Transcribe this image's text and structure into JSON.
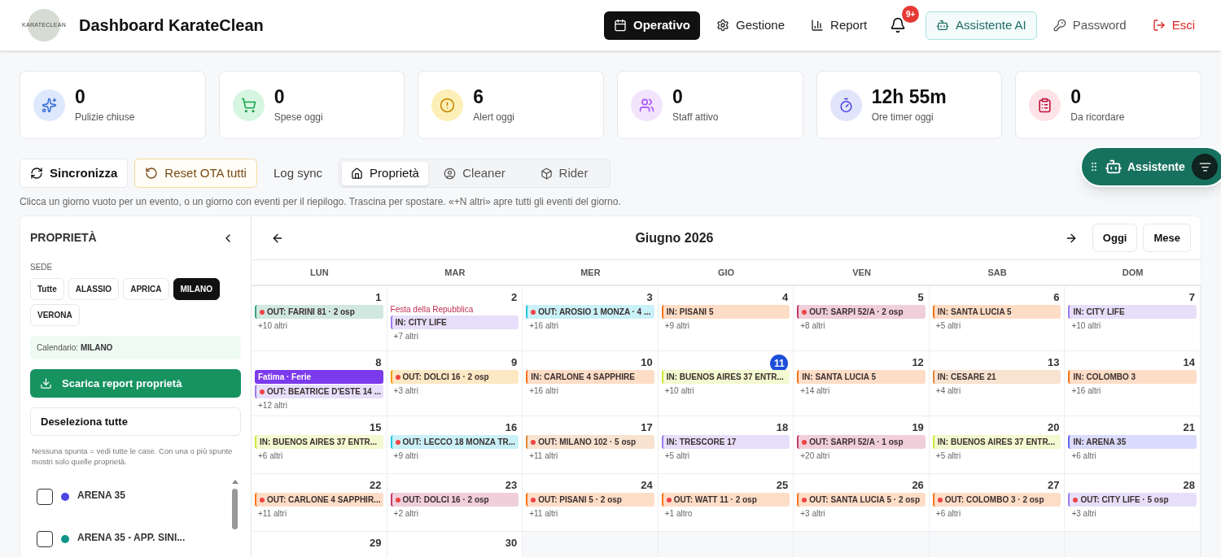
{
  "header": {
    "logo_text": "KARATECLEAN",
    "title": "Dashboard KarateClean",
    "nav": [
      {
        "label": "Operativo",
        "selected": true
      },
      {
        "label": "Gestione",
        "selected": false
      },
      {
        "label": "Report",
        "selected": false
      }
    ],
    "notifications_badge": "9+",
    "actions": [
      {
        "label": "Assistente AI",
        "kind": "ai"
      },
      {
        "label": "Password",
        "kind": "plain"
      },
      {
        "label": "Esci",
        "kind": "danger"
      }
    ]
  },
  "stats": [
    {
      "value": "0",
      "label": "Pulizie chiuse"
    },
    {
      "value": "0",
      "label": "Spese oggi"
    },
    {
      "value": "6",
      "label": "Alert oggi"
    },
    {
      "value": "0",
      "label": "Staff attivo"
    },
    {
      "value": "12h 55m",
      "label": "Ore timer oggi"
    },
    {
      "value": "0",
      "label": "Da ricordare"
    }
  ],
  "toolbar": {
    "sync": "Sincronizza",
    "reset": "Reset OTA tutti",
    "log": "Log sync",
    "views": [
      {
        "label": "Proprietà",
        "selected": true
      },
      {
        "label": "Cleaner",
        "selected": false
      },
      {
        "label": "Rider",
        "selected": false
      }
    ]
  },
  "assistant_button": "Assistente",
  "hint": "Clicca un giorno vuoto per un evento, o un giorno con eventi per il riepilogo. Trascina per spostare. «+N altri» apre tutti gli eventi del giorno.",
  "sidebar": {
    "title": "PROPRIETÀ",
    "sede_label": "SEDE",
    "sedi": [
      {
        "label": "Tutte",
        "selected": false
      },
      {
        "label": "ALASSIO",
        "selected": false
      },
      {
        "label": "APRICA",
        "selected": false
      },
      {
        "label": "MILANO",
        "selected": true
      },
      {
        "label": "VERONA",
        "selected": false
      }
    ],
    "calendar_label": "Calendario:",
    "calendar_value": "MILANO",
    "download": "Scarica report proprietà",
    "deselect": "Deseleziona tutte",
    "note": "Nessuna spunta = vedi tutte le case. Con una o più spunte mostri solo quelle proprietà.",
    "properties": [
      {
        "name": "ARENA 35",
        "checked": false,
        "color": "#4f46e5"
      },
      {
        "name": "ARENA 35 - APP. SINI...",
        "checked": false,
        "color": "#0d9488"
      }
    ]
  },
  "calendar": {
    "month": "Giugno 2026",
    "today_button": "Oggi",
    "view_button": "Mese",
    "weekdays": [
      "LUN",
      "MAR",
      "MER",
      "GIO",
      "VEN",
      "SAB",
      "DOM"
    ],
    "weeks": [
      [
        {
          "day": "1",
          "today": false,
          "events": [
            {
              "kind": "out",
              "label": "OUT: FARINI 81 · 2 osp",
              "color": "#3aa17e"
            }
          ],
          "more": "+10 altri"
        },
        {
          "day": "2",
          "today": false,
          "holiday": "Festa della Repubblica",
          "events": [
            {
              "kind": "in",
              "label": "IN: CITY LIFE",
              "color": "#9b7bea"
            }
          ],
          "more": "+7 altri"
        },
        {
          "day": "3",
          "today": false,
          "events": [
            {
              "kind": "out",
              "label": "OUT: AROSIO 1 MONZA · 4 ...",
              "color": "#22c5de"
            }
          ],
          "more": "+16 altri"
        },
        {
          "day": "4",
          "today": false,
          "events": [
            {
              "kind": "in",
              "label": "IN: PISANI 5",
              "color": "#f97316"
            }
          ],
          "more": "+9 altri"
        },
        {
          "day": "5",
          "today": false,
          "events": [
            {
              "kind": "out",
              "label": "OUT: SARPI 52/A · 2 osp",
              "color": "#c0396b"
            }
          ],
          "more": "+8 altri"
        },
        {
          "day": "6",
          "today": false,
          "events": [
            {
              "kind": "in",
              "label": "IN: SANTA LUCIA 5",
              "color": "#f97316"
            }
          ],
          "more": "+5 altri"
        },
        {
          "day": "7",
          "today": false,
          "events": [
            {
              "kind": "in",
              "label": "IN: CITY LIFE",
              "color": "#9b7bea"
            }
          ],
          "more": "+10 altri"
        }
      ],
      [
        {
          "day": "8",
          "today": false,
          "events": [
            {
              "kind": "leave",
              "label": "Fatima · Ferie",
              "color": "#7c3aed"
            },
            {
              "kind": "out",
              "label": "OUT: BEATRICE D'ESTE 14 ...",
              "color": "#9b7bea"
            }
          ],
          "more": "+12 altri"
        },
        {
          "day": "9",
          "today": false,
          "events": [
            {
              "kind": "out",
              "label": "OUT: DOLCI 16 · 2 osp",
              "color": "#f59e0b"
            }
          ],
          "more": "+3 altri"
        },
        {
          "day": "10",
          "today": false,
          "events": [
            {
              "kind": "in",
              "label": "IN: CARLONE 4 SAPPHIRE",
              "color": "#f97316"
            }
          ],
          "more": "+16 altri"
        },
        {
          "day": "11",
          "today": true,
          "events": [
            {
              "kind": "in",
              "label": "IN: BUENOS AIRES 37 ENTR...",
              "color": "#cde83a"
            }
          ],
          "more": "+10 altri"
        },
        {
          "day": "12",
          "today": false,
          "events": [
            {
              "kind": "in",
              "label": "IN: SANTA LUCIA 5",
              "color": "#f97316"
            }
          ],
          "more": "+14 altri"
        },
        {
          "day": "13",
          "today": false,
          "events": [
            {
              "kind": "in",
              "label": "IN: CESARE 21",
              "color": "#e2873a"
            }
          ],
          "more": "+4 altri"
        },
        {
          "day": "14",
          "today": false,
          "events": [
            {
              "kind": "in",
              "label": "IN: COLOMBO 3",
              "color": "#f97316"
            }
          ],
          "more": "+16 altri"
        }
      ],
      [
        {
          "day": "15",
          "today": false,
          "events": [
            {
              "kind": "in",
              "label": "IN: BUENOS AIRES 37 ENTR...",
              "color": "#cde83a"
            }
          ],
          "more": "+6 altri"
        },
        {
          "day": "16",
          "today": false,
          "events": [
            {
              "kind": "out",
              "label": "OUT: LECCO 18 MONZA TR...",
              "color": "#22c5de"
            }
          ],
          "more": "+9 altri"
        },
        {
          "day": "17",
          "today": false,
          "events": [
            {
              "kind": "out",
              "label": "OUT: MILANO 102 · 5 osp",
              "color": "#e2873a"
            }
          ],
          "more": "+11 altri"
        },
        {
          "day": "18",
          "today": false,
          "events": [
            {
              "kind": "in",
              "label": "IN: TRESCORE 17",
              "color": "#9b7bea"
            }
          ],
          "more": "+5 altri"
        },
        {
          "day": "19",
          "today": false,
          "events": [
            {
              "kind": "out",
              "label": "OUT: SARPI 52/A · 1 osp",
              "color": "#c0396b"
            }
          ],
          "more": "+20 altri"
        },
        {
          "day": "20",
          "today": false,
          "events": [
            {
              "kind": "in",
              "label": "IN: BUENOS AIRES 37 ENTR...",
              "color": "#cde83a"
            }
          ],
          "more": "+5 altri"
        },
        {
          "day": "21",
          "today": false,
          "events": [
            {
              "kind": "in",
              "label": "IN: ARENA 35",
              "color": "#6366f1"
            }
          ],
          "more": "+6 altri"
        }
      ],
      [
        {
          "day": "22",
          "today": false,
          "events": [
            {
              "kind": "out",
              "label": "OUT: CARLONE 4 SAPPHIR...",
              "color": "#f97316"
            }
          ],
          "more": "+11 altri"
        },
        {
          "day": "23",
          "today": false,
          "events": [
            {
              "kind": "out",
              "label": "OUT: DOLCI 16 · 2 osp",
              "color": "#c0396b"
            }
          ],
          "more": "+2 altri"
        },
        {
          "day": "24",
          "today": false,
          "events": [
            {
              "kind": "out",
              "label": "OUT: PISANI 5 · 2 osp",
              "color": "#f97316"
            }
          ],
          "more": "+11 altri"
        },
        {
          "day": "25",
          "today": false,
          "events": [
            {
              "kind": "out",
              "label": "OUT: WATT 11 · 2 osp",
              "color": "#f97316"
            }
          ],
          "more": "+1 altro"
        },
        {
          "day": "26",
          "today": false,
          "events": [
            {
              "kind": "out",
              "label": "OUT: SANTA LUCIA 5 · 2 osp",
              "color": "#f97316"
            }
          ],
          "more": "+3 altri"
        },
        {
          "day": "27",
          "today": false,
          "events": [
            {
              "kind": "out",
              "label": "OUT: COLOMBO 3 · 2 osp",
              "color": "#f97316"
            }
          ],
          "more": "+6 altri"
        },
        {
          "day": "28",
          "today": false,
          "events": [
            {
              "kind": "out",
              "label": "OUT: CITY LIFE · 5 osp",
              "color": "#9b7bea"
            }
          ],
          "more": "+3 altri"
        }
      ],
      [
        {
          "day": "29",
          "today": false
        },
        {
          "day": "30",
          "today": false
        }
      ]
    ]
  }
}
